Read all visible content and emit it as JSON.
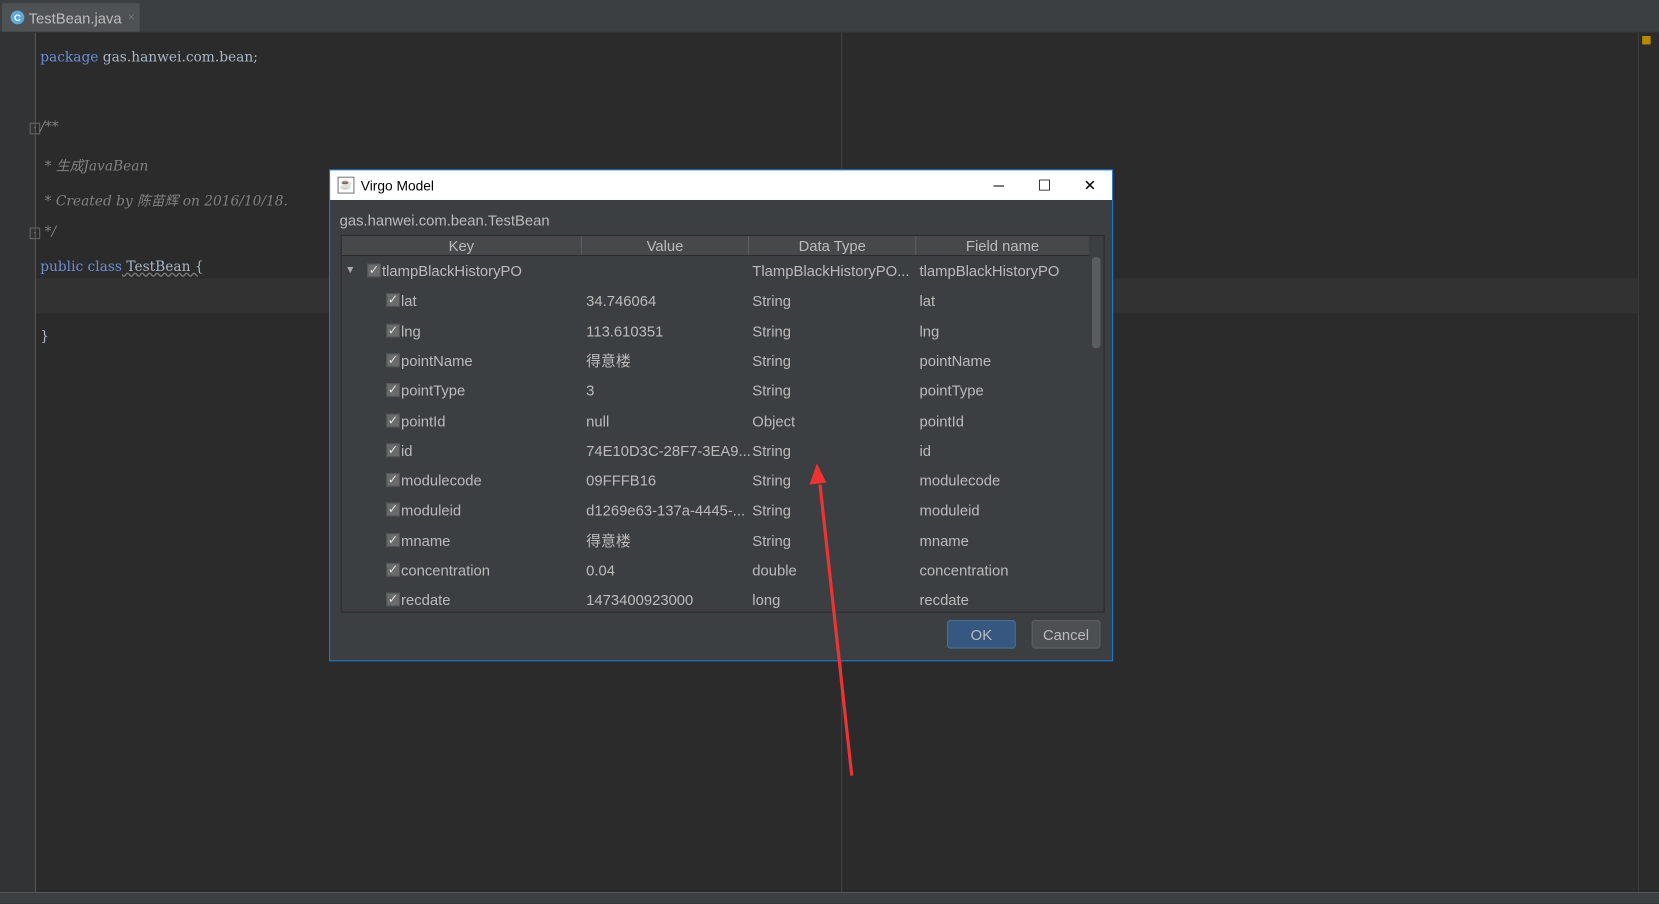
{
  "editor": {
    "tab": {
      "label": "TestBean.java",
      "icon": "class-icon",
      "close": "×"
    },
    "lines": {
      "l1_kw": "package",
      "l1_rest": " gas.hanwei.com.bean;",
      "l2": "/**",
      "l3": " * 生成JavaBean",
      "l4": " * Created by 陈苗辉 on 2016/10/18.",
      "l5": " */",
      "l6_kw": "public class",
      "l6_rest": " TestBean {",
      "l7": "}"
    }
  },
  "dialog": {
    "title": "Virgo Model",
    "class_name": "gas.hanwei.com.bean.TestBean",
    "columns": [
      "Key",
      "Value",
      "Data Type",
      "Field name"
    ],
    "rows": [
      {
        "key": "tlampBlackHistoryPO",
        "value": "",
        "type": "TlampBlackHistoryPO...",
        "field": "tlampBlackHistoryPO",
        "checked": true,
        "expanded": true,
        "level": 0
      },
      {
        "key": "lat",
        "value": "34.746064",
        "type": "String",
        "field": "lat",
        "checked": true,
        "level": 1
      },
      {
        "key": "lng",
        "value": "113.610351",
        "type": "String",
        "field": "lng",
        "checked": true,
        "level": 1
      },
      {
        "key": "pointName",
        "value": "得意楼",
        "type": "String",
        "field": "pointName",
        "checked": true,
        "level": 1
      },
      {
        "key": "pointType",
        "value": "3",
        "type": "String",
        "field": "pointType",
        "checked": true,
        "level": 1
      },
      {
        "key": "pointId",
        "value": "null",
        "type": "Object",
        "field": "pointId",
        "checked": true,
        "level": 1
      },
      {
        "key": "id",
        "value": "74E10D3C-28F7-3EA9...",
        "type": "String",
        "field": "id",
        "checked": true,
        "level": 1
      },
      {
        "key": "modulecode",
        "value": "09FFFB16",
        "type": "String",
        "field": "modulecode",
        "checked": true,
        "level": 1
      },
      {
        "key": "moduleid",
        "value": "d1269e63-137a-4445-...",
        "type": "String",
        "field": "moduleid",
        "checked": true,
        "level": 1
      },
      {
        "key": "mname",
        "value": "得意楼",
        "type": "String",
        "field": "mname",
        "checked": true,
        "level": 1
      },
      {
        "key": "concentration",
        "value": "0.04",
        "type": "double",
        "field": "concentration",
        "checked": true,
        "level": 1
      },
      {
        "key": "recdate",
        "value": "1473400923000",
        "type": "long",
        "field": "recdate",
        "checked": true,
        "level": 1
      }
    ],
    "ok_label": "OK",
    "cancel_label": "Cancel",
    "window_buttons": {
      "minimize": "─",
      "maximize": "☐",
      "close": "✕"
    }
  },
  "colors": {
    "accent": "#1a7ad4",
    "annotation_arrow": "#ee3333",
    "keyword": "#6b8fd6"
  }
}
